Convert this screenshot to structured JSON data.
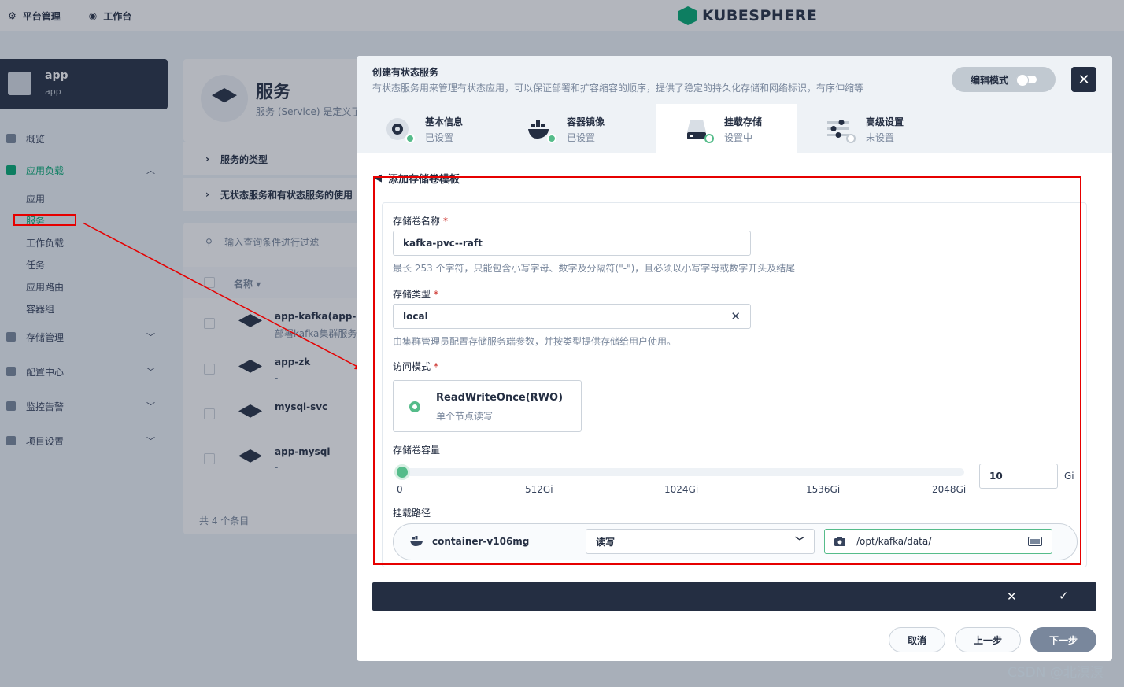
{
  "topbar": {
    "platform_label": "平台管理",
    "workbench_label": "工作台",
    "logo_text": "KUBESPHERE"
  },
  "project": {
    "name": "app",
    "sub": "app"
  },
  "sidebar": {
    "overview": "概览",
    "app_workloads": "应用负载",
    "sub": [
      "应用",
      "服务",
      "工作负载",
      "任务",
      "应用路由",
      "容器组"
    ],
    "storage": "存储管理",
    "config": "配置中心",
    "monitoring": "监控告警",
    "settings": "项目设置"
  },
  "services_page": {
    "title": "服务",
    "desc": "服务 (Service) 是定义了",
    "collapse_1": "服务的类型",
    "collapse_2": "无状态服务和有状态服务的使用",
    "filter_placeholder": "输入查询条件进行过滤",
    "col_name": "名称",
    "rows": [
      {
        "name": "app-kafka(app-kafk",
        "sub": "部署kafka集群服务"
      },
      {
        "name": "app-zk",
        "sub": "-"
      },
      {
        "name": "mysql-svc",
        "sub": "-"
      },
      {
        "name": "app-mysql",
        "sub": "-"
      }
    ],
    "total": "共 4 个条目"
  },
  "modal": {
    "title": "创建有状态服务",
    "desc": "有状态服务用来管理有状态应用，可以保证部署和扩容缩容的顺序，提供了稳定的持久化存储和网络标识，有序伸缩等",
    "edit_mode": "编辑模式",
    "steps": [
      {
        "title": "基本信息",
        "status": "已设置"
      },
      {
        "title": "容器镜像",
        "status": "已设置"
      },
      {
        "title": "挂载存储",
        "status": "设置中"
      },
      {
        "title": "高级设置",
        "status": "未设置"
      }
    ],
    "back_label": "添加存储卷模板",
    "form": {
      "volume_name_label": "存储卷名称",
      "volume_name_value": "kafka-pvc--raft",
      "volume_name_hint": "最长 253 个字符，只能包含小写字母、数字及分隔符(\"-\")，且必须以小写字母或数字开头及结尾",
      "storage_class_label": "存储类型",
      "storage_class_value": "local",
      "storage_class_hint": "由集群管理员配置存储服务端参数，并按类型提供存储给用户使用。",
      "access_mode_label": "访问模式",
      "access_mode_title": "ReadWriteOnce(RWO)",
      "access_mode_sub": "单个节点读写",
      "capacity_label": "存储卷容量",
      "capacity_value": "10",
      "capacity_max": 2048,
      "capacity_unit": "Gi",
      "ticks": [
        "0",
        "512Gi",
        "1024Gi",
        "1536Gi",
        "2048Gi"
      ],
      "mount_label": "挂载路径",
      "container_name": "container-v106mg",
      "mount_mode": "读写",
      "mount_path": "/opt/kafka/data/"
    },
    "buttons": {
      "cancel": "取消",
      "prev": "上一步",
      "next": "下一步"
    }
  },
  "watermark": "CSDN @北溟溟",
  "colors": {
    "accent": "#55bc8a",
    "dark": "#242e42",
    "annotation": "#e60000"
  }
}
